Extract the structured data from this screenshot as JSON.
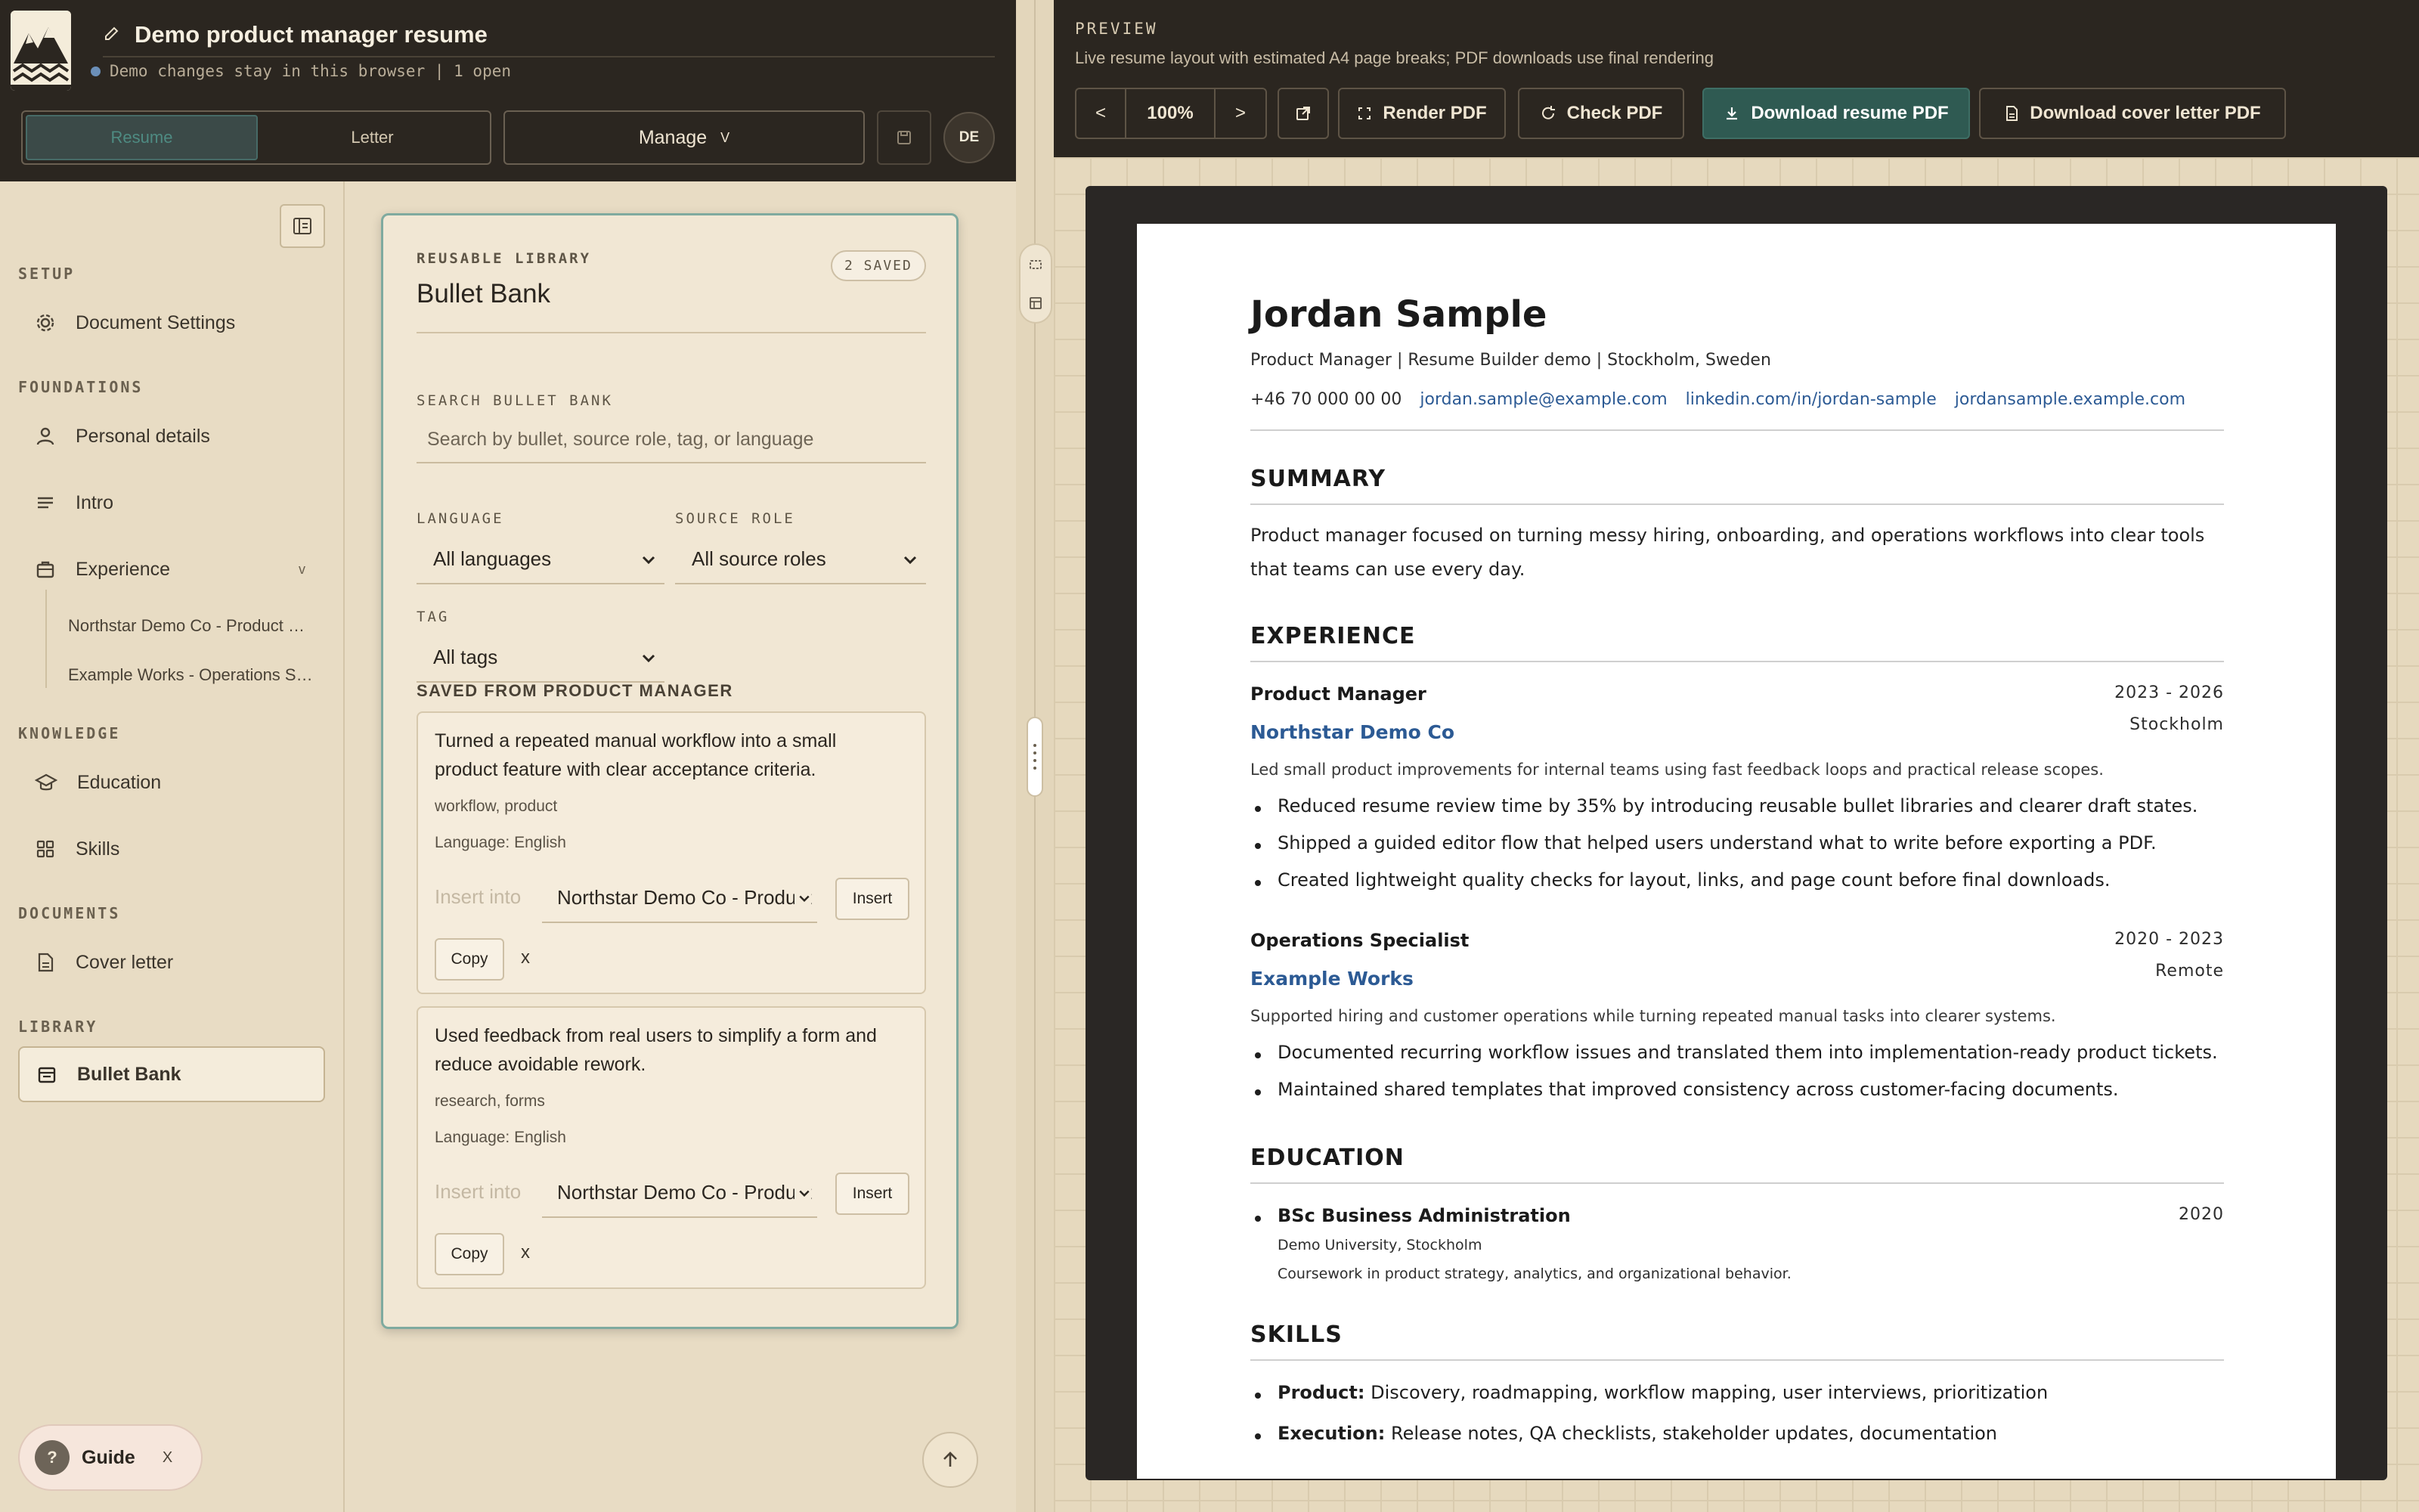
{
  "header": {
    "doc_title": "Demo product manager resume",
    "status_text": "Demo changes stay in this browser | 1 open",
    "tabs": [
      "Resume",
      "Letter"
    ],
    "manage_label": "Manage",
    "manage_chevron": "V",
    "lang_badge": "DE"
  },
  "sidebar": {
    "sections": {
      "setup": "SETUP",
      "foundations": "FOUNDATIONS",
      "knowledge": "KNOWLEDGE",
      "documents": "DOCUMENTS",
      "library": "LIBRARY"
    },
    "items": {
      "document_settings": "Document Settings",
      "personal_details": "Personal details",
      "intro": "Intro",
      "experience": "Experience",
      "experience_chevron": "v",
      "exp_sub_1": "Northstar Demo Co - Product Manager",
      "exp_sub_2": "Example Works - Operations Specialist",
      "education": "Education",
      "skills": "Skills",
      "cover_letter": "Cover letter",
      "bullet_bank": "Bullet Bank"
    },
    "guide": {
      "q": "?",
      "label": "Guide",
      "close": "X"
    }
  },
  "library": {
    "kicker": "REUSABLE LIBRARY",
    "title": "Bullet Bank",
    "saved_badge": "2 SAVED",
    "search_label": "SEARCH BULLET BANK",
    "search_placeholder": "Search by bullet, source role, tag, or language",
    "language_label": "LANGUAGE",
    "language_value": "All languages",
    "source_role_label": "SOURCE ROLE",
    "source_role_value": "All source roles",
    "tag_label": "TAG",
    "tag_value": "All tags",
    "group_title": "SAVED FROM PRODUCT MANAGER",
    "bullets": [
      {
        "text": "Turned a repeated manual workflow into a small product feature with clear acceptance criteria.",
        "tags": "workflow, product",
        "language": "Language: English",
        "insert_label": "Insert into",
        "target": "Northstar Demo Co - Product Manager",
        "insert_btn": "Insert",
        "copy_btn": "Copy",
        "remove": "x"
      },
      {
        "text": "Used feedback from real users to simplify a form and reduce avoidable rework.",
        "tags": "research, forms",
        "language": "Language: English",
        "insert_label": "Insert into",
        "target": "Northstar Demo Co - Product Manager",
        "insert_btn": "Insert",
        "copy_btn": "Copy",
        "remove": "x"
      }
    ]
  },
  "preview": {
    "kicker": "PREVIEW",
    "description": "Live resume layout with estimated A4 page breaks; PDF downloads use final rendering",
    "zoom_prev": "<",
    "zoom": "100%",
    "zoom_next": ">",
    "render_pdf": "Render PDF",
    "check_pdf": "Check PDF",
    "download_resume": "Download resume PDF",
    "download_letter": "Download cover letter PDF"
  },
  "resume": {
    "name": "Jordan Sample",
    "subline": "Product Manager | Resume Builder demo | Stockholm, Sweden",
    "phone": "+46 70 000 00 00",
    "email": "jordan.sample@example.com",
    "linkedin": "linkedin.com/in/jordan-sample",
    "website": "jordansample.example.com",
    "summary_head": "SUMMARY",
    "summary": "Product manager focused on turning messy hiring, onboarding, and operations workflows into clear tools that teams can use every day.",
    "experience_head": "EXPERIENCE",
    "jobs": [
      {
        "role": "Product Manager",
        "dates": "2023 - 2026",
        "company": "Northstar Demo Co",
        "location": "Stockholm",
        "desc": "Led small product improvements for internal teams using fast feedback loops and practical release scopes.",
        "bullets": [
          "Reduced resume review time by 35% by introducing reusable bullet libraries and clearer draft states.",
          "Shipped a guided editor flow that helped users understand what to write before exporting a PDF.",
          "Created lightweight quality checks for layout, links, and page count before final downloads."
        ]
      },
      {
        "role": "Operations Specialist",
        "dates": "2020 - 2023",
        "company": "Example Works",
        "location": "Remote",
        "desc": "Supported hiring and customer operations while turning repeated manual tasks into clearer systems.",
        "bullets": [
          "Documented recurring workflow issues and translated them into implementation-ready product tickets.",
          "Maintained shared templates that improved consistency across customer-facing documents."
        ]
      }
    ],
    "education_head": "EDUCATION",
    "edu": {
      "degree": "BSc Business Administration",
      "year": "2020",
      "school": "Demo University, Stockholm",
      "note": "Coursework in product strategy, analytics, and organizational behavior."
    },
    "skills_head": "SKILLS",
    "skills": [
      {
        "label": "Product:",
        "value": " Discovery, roadmapping, workflow mapping, user interviews, prioritization"
      },
      {
        "label": "Execution:",
        "value": " Release notes, QA checklists, stakeholder updates, documentation"
      }
    ]
  },
  "colors": {
    "accent": "#2f5a52",
    "link": "#2c5a94",
    "dark_header": "#2b2620",
    "card_border": "#7faa9f"
  }
}
